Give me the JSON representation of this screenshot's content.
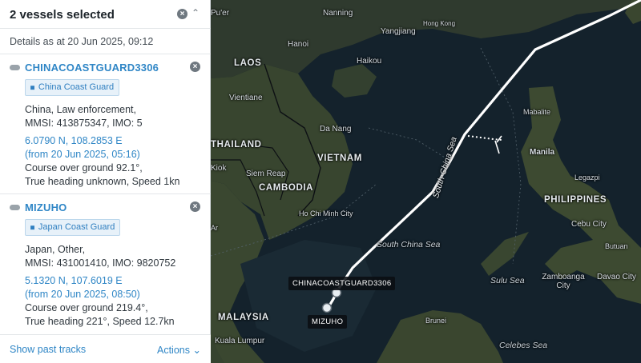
{
  "panel": {
    "title": "2 vessels selected",
    "details_label": "Details as at 20 Jun 2025, 09:12",
    "footer": {
      "past_tracks": "Show past tracks",
      "actions": "Actions ⌄"
    }
  },
  "vessels": [
    {
      "name": "CHINACOASTGUARD3306",
      "badge": "China Coast Guard",
      "line1": "China, Law enforcement,",
      "line2": "MMSI: 413875347, IMO: 5",
      "coords": "6.0790 N, 108.2853 E",
      "coords_time": "(from 20 Jun 2025, 05:16)",
      "course": "Course over ground 92.1°,",
      "heading": "True heading unknown, Speed 1kn"
    },
    {
      "name": "MIZUHO",
      "badge": "Japan Coast Guard",
      "line1": "Japan, Other,",
      "line2": "MMSI: 431001410, IMO: 9820752",
      "coords": "5.1320 N, 107.6019 E",
      "coords_time": "(from 20 Jun 2025, 08:50)",
      "course": "Course over ground 219.4°,",
      "heading": "True heading 221°, Speed 12.7kn"
    }
  ],
  "map": {
    "cities": [
      "Pu'er",
      "Nanning",
      "Hong Kong",
      "Yangjiang",
      "Hanoi",
      "Haikou",
      "Vientiane",
      "Da Nang",
      "Siem Reap",
      "Ho Chi Minh City",
      "Kuala Lumpur",
      "Legazpi",
      "Cebu City",
      "Butuan",
      "Zamboanga City",
      "Davao City",
      "Mabalite",
      "Manila",
      "Brunei",
      "Kiok",
      "Ar"
    ],
    "countries": [
      "LAOS",
      "THAILAND",
      "VIETNAM",
      "CAMBODIA",
      "PHILIPPINES",
      "MALAYSIA"
    ],
    "seas": [
      "South China Sea",
      "South China Sea",
      "Sulu Sea",
      "Celebes Sea"
    ],
    "vessel_labels": [
      "CHINACOASTGUARD3306",
      "MIZUHO"
    ]
  }
}
